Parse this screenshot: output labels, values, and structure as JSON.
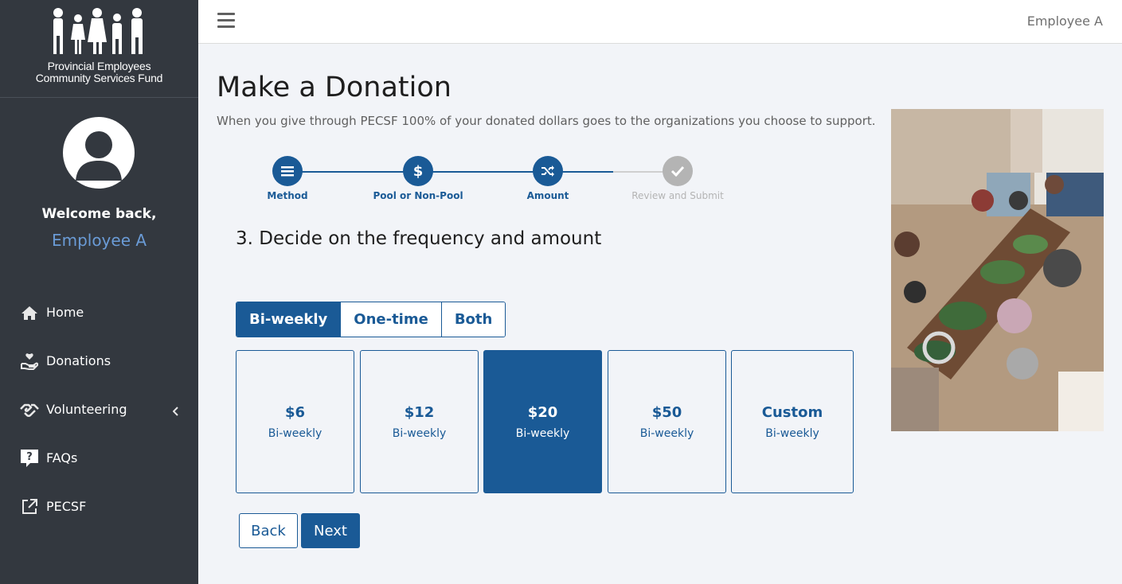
{
  "sidebar": {
    "logo_line1": "Provincial Employees",
    "logo_line2": "Community Services Fund",
    "welcome": "Welcome back,",
    "user_name": "Employee A",
    "items": [
      {
        "label": "Home",
        "icon": "home-icon"
      },
      {
        "label": "Donations",
        "icon": "donations-icon"
      },
      {
        "label": "Volunteering",
        "icon": "handshake-icon"
      },
      {
        "label": "FAQs",
        "icon": "faq-icon"
      },
      {
        "label": "PECSF",
        "icon": "external-link-icon"
      }
    ]
  },
  "topbar": {
    "user": "Employee A"
  },
  "main": {
    "title": "Make a Donation",
    "subtitle": "When you give through PECSF 100% of your donated dollars goes to the organizations you choose to support.",
    "steps": [
      {
        "label": "Method",
        "icon": "list-icon",
        "state": "complete"
      },
      {
        "label": "Pool or Non-Pool",
        "icon": "dollar-icon",
        "state": "complete"
      },
      {
        "label": "Amount",
        "icon": "shuffle-icon",
        "state": "current"
      },
      {
        "label": "Review and Submit",
        "icon": "check-icon",
        "state": "pending"
      }
    ],
    "section_title": "3. Decide on the frequency and amount",
    "frequency": {
      "options": [
        "Bi-weekly",
        "One-time",
        "Both"
      ],
      "selected": "Bi-weekly"
    },
    "amounts": [
      {
        "amount": "$6",
        "period": "Bi-weekly",
        "selected": false
      },
      {
        "amount": "$12",
        "period": "Bi-weekly",
        "selected": false
      },
      {
        "amount": "$20",
        "period": "Bi-weekly",
        "selected": true
      },
      {
        "amount": "$50",
        "period": "Bi-weekly",
        "selected": false
      },
      {
        "amount": "Custom",
        "period": "Bi-weekly",
        "selected": false
      }
    ],
    "back_label": "Back",
    "next_label": "Next"
  },
  "colors": {
    "primary": "#1a5a96",
    "sidebar": "#33383f",
    "accent_name": "#6a9bd6",
    "inactive_step": "#b4b4b4"
  }
}
